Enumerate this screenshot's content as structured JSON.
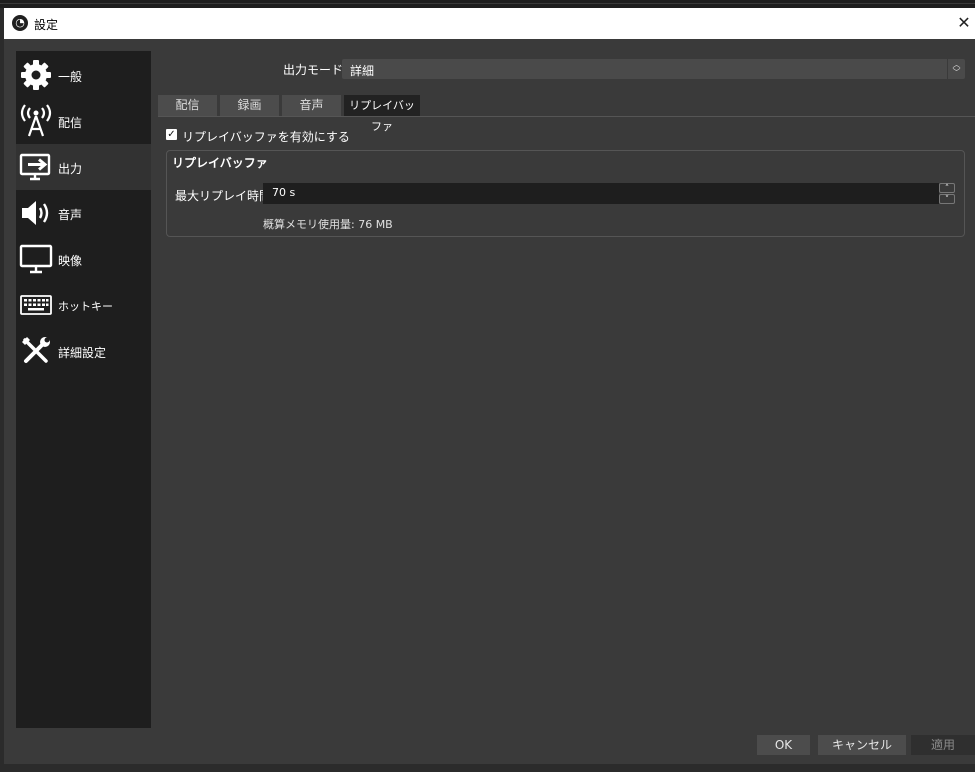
{
  "window": {
    "title": "設定",
    "close_glyph": "✕"
  },
  "sidebar": {
    "items": [
      {
        "label": "一般",
        "icon": "gear-icon"
      },
      {
        "label": "配信",
        "icon": "broadcast-tower-icon"
      },
      {
        "label": "出力",
        "icon": "output-monitor-icon",
        "active": true
      },
      {
        "label": "音声",
        "icon": "speaker-icon"
      },
      {
        "label": "映像",
        "icon": "monitor-icon"
      },
      {
        "label": "ホットキー",
        "icon": "keyboard-icon"
      },
      {
        "label": "詳細設定",
        "icon": "tools-icon"
      }
    ]
  },
  "output": {
    "mode_label": "出力モード",
    "mode_value": "詳細",
    "tabs": [
      "配信",
      "録画",
      "音声",
      "リプレイバッファ"
    ],
    "active_tab": "リプレイバッファ",
    "replay": {
      "enable_label": "リプレイバッファを有効にする",
      "enabled": true,
      "group_title": "リプレイバッファ",
      "max_time_label": "最大リプレイ時間",
      "max_time_value": "70 s",
      "memory_text": "概算メモリ使用量: 76 MB"
    }
  },
  "buttons": {
    "ok": "OK",
    "cancel": "キャンセル",
    "apply": "適用"
  }
}
